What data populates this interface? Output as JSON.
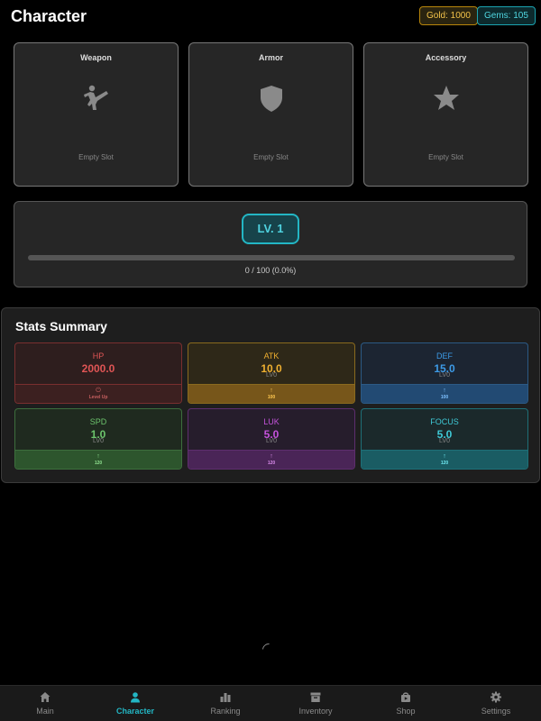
{
  "header": {
    "title": "Character",
    "gold_label": "Gold: 1000",
    "gems_label": "Gems: 105"
  },
  "equipment": {
    "slots": [
      {
        "label": "Weapon",
        "status": "Empty Slot",
        "icon": "martial-arts-kick-icon"
      },
      {
        "label": "Armor",
        "status": "Empty Slot",
        "icon": "shield-icon"
      },
      {
        "label": "Accessory",
        "status": "Empty Slot",
        "icon": "star-icon"
      }
    ]
  },
  "level": {
    "badge": "LV. 1",
    "progress_text": "0 / 100 (0.0%)",
    "progress_fraction": 0.0
  },
  "stats": {
    "title": "Stats Summary",
    "tiles": [
      {
        "name": "HP",
        "value": "2000.0",
        "button_arrow": "⏻",
        "button_label": "Level Up"
      },
      {
        "name": "ATK",
        "value": "10.0",
        "level": "LV0",
        "button_arrow": "↑",
        "button_label": "100"
      },
      {
        "name": "DEF",
        "value": "15.0",
        "level": "LV0",
        "button_arrow": "↑",
        "button_label": "100"
      },
      {
        "name": "SPD",
        "value": "1.0",
        "level": "LV0",
        "button_arrow": "↑",
        "button_label": "120"
      },
      {
        "name": "LUK",
        "value": "5.0",
        "level": "LV0",
        "button_arrow": "↑",
        "button_label": "120"
      },
      {
        "name": "FOCUS",
        "value": "5.0",
        "level": "LV0",
        "button_arrow": "↑",
        "button_label": "120"
      }
    ]
  },
  "nav": {
    "items": [
      {
        "label": "Main",
        "icon": "home-icon"
      },
      {
        "label": "Character",
        "icon": "person-icon",
        "active": true
      },
      {
        "label": "Ranking",
        "icon": "bar-chart-icon"
      },
      {
        "label": "Inventory",
        "icon": "archive-box-icon"
      },
      {
        "label": "Shop",
        "icon": "shopping-bag-icon"
      },
      {
        "label": "Settings",
        "icon": "gear-icon"
      }
    ]
  },
  "colors": {
    "accent": "#23b6c4",
    "gold": "#f3c34a",
    "gems": "#4fd6e0"
  }
}
